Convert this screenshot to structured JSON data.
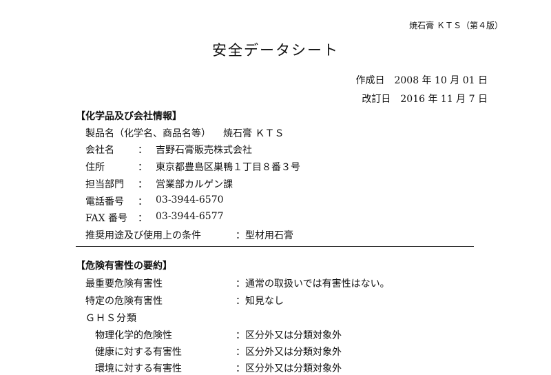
{
  "header": {
    "doc_code": "焼石膏 ＫＴＳ（第４版）"
  },
  "title": "安全データシート",
  "dates": {
    "created": "作成日　2008 年 10 月 01 日",
    "revised": "改訂日　2016 年 11 月 7 日"
  },
  "sections": {
    "product": {
      "heading": "【化学品及び会社情報】",
      "rows": [
        {
          "label": "製品名（化学名、商品名等）",
          "sep": "",
          "value": "焼石膏 ＫＴＳ"
        },
        {
          "label": "会社名",
          "sep": "：",
          "value": "吉野石膏販売株式会社"
        },
        {
          "label": "住所",
          "sep": "：",
          "value": "東京都豊島区巣鴨１丁目８番３号"
        },
        {
          "label": "担当部門",
          "sep": "：",
          "value": "営業部カルゲン課"
        },
        {
          "label": "電話番号",
          "sep": "：",
          "value": "03-3944-6570"
        },
        {
          "label": "FAX 番号",
          "sep": "：",
          "value": "03-3944-6577"
        },
        {
          "label": "推奨用途及び使用上の条件",
          "sep": "：",
          "value": "型材用石膏"
        }
      ]
    },
    "hazard": {
      "heading": "【危険有害性の要約】",
      "rows": [
        {
          "label": "最重要危険有害性",
          "sep": "：",
          "value": "通常の取扱いでは有害性はない。"
        },
        {
          "label": "特定の危険有害性",
          "sep": "：",
          "value": "知見なし"
        }
      ],
      "ghs_heading": "ＧＨＳ分類",
      "ghs_rows": [
        {
          "label": "物理化学的危険性",
          "sep": "：",
          "value": "区分外又は分類対象外"
        },
        {
          "label": "健康に対する有害性",
          "sep": "：",
          "value": "区分外又は分類対象外"
        },
        {
          "label": "環境に対する有害性",
          "sep": "：",
          "value": "区分外又は分類対象外"
        }
      ]
    }
  }
}
